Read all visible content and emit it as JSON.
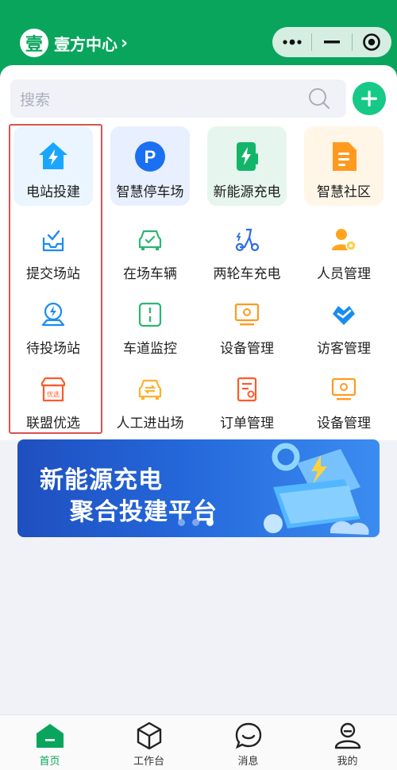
{
  "header": {
    "logo_char": "壹",
    "title": "壹方中心",
    "chevron": "›"
  },
  "capsule": {
    "more": "•••",
    "minimize": "—",
    "close_icon": "record-icon"
  },
  "search": {
    "placeholder": "搜索",
    "icon": "search-icon",
    "add_icon": "plus-icon"
  },
  "featured": [
    {
      "label": "电站投建",
      "icon": "house-bolt-icon",
      "bg": "#eaf5ff"
    },
    {
      "label": "智慧停车场",
      "icon": "parking-icon",
      "bg": "#e8f0ff"
    },
    {
      "label": "新能源充电",
      "icon": "charging-pile-icon",
      "bg": "#e6f6ee"
    },
    {
      "label": "智慧社区",
      "icon": "document-icon",
      "bg": "#fff6e8"
    }
  ],
  "grid": [
    [
      {
        "label": "提交场站",
        "icon": "inbox-check-icon"
      },
      {
        "label": "在场车辆",
        "icon": "car-check-icon"
      },
      {
        "label": "两轮车充电",
        "icon": "scooter-icon"
      },
      {
        "label": "人员管理",
        "icon": "user-gear-icon"
      }
    ],
    [
      {
        "label": "待投场站",
        "icon": "map-bolt-icon"
      },
      {
        "label": "车道监控",
        "icon": "lane-icon"
      },
      {
        "label": "设备管理",
        "icon": "device-icon"
      },
      {
        "label": "访客管理",
        "icon": "handshake-icon"
      }
    ],
    [
      {
        "label": "联盟优选",
        "icon": "shop-icon",
        "badge": "优选"
      },
      {
        "label": "人工进出场",
        "icon": "car-swap-icon"
      },
      {
        "label": "订单管理",
        "icon": "order-icon"
      },
      {
        "label": "设备管理",
        "icon": "device-icon"
      }
    ]
  ],
  "banner": {
    "line1": "新能源充电",
    "line2": "聚合投建平台",
    "slides": 3,
    "active_slide": 3
  },
  "tabbar": [
    {
      "label": "首页",
      "icon": "home-icon",
      "active": true
    },
    {
      "label": "工作台",
      "icon": "cube-icon",
      "active": false
    },
    {
      "label": "消息",
      "icon": "chat-icon",
      "active": false
    },
    {
      "label": "我的",
      "icon": "user-icon",
      "active": false
    }
  ],
  "colors": {
    "brand": "#09a55c",
    "highlight": "#d9534f",
    "accent": "#16c987"
  }
}
